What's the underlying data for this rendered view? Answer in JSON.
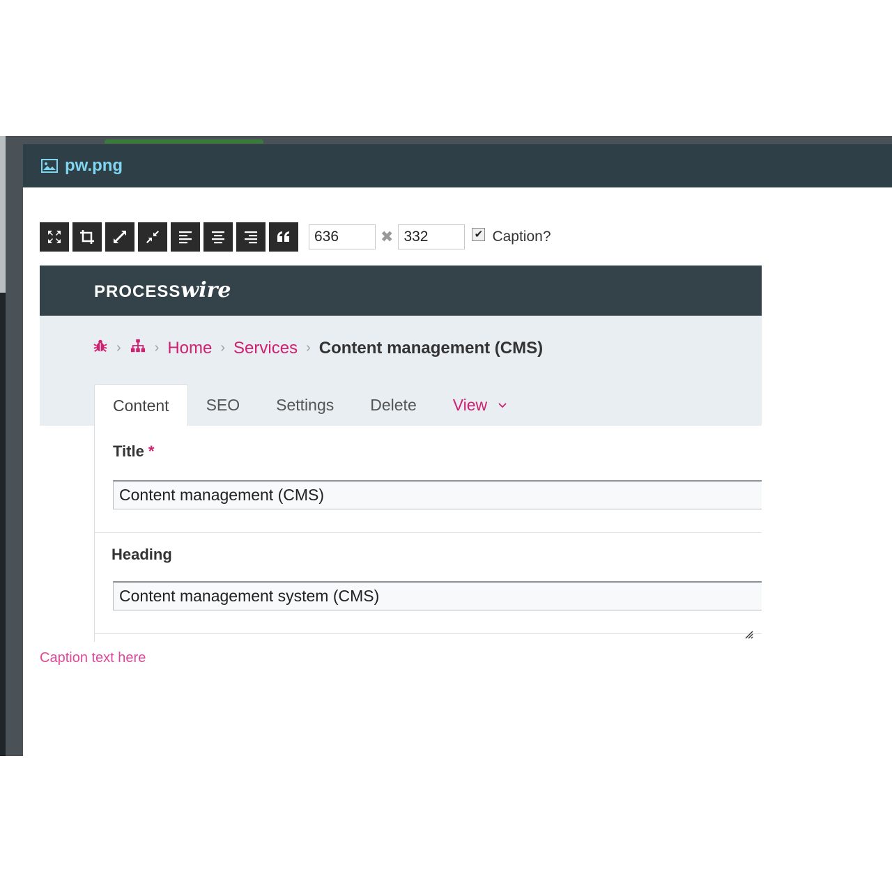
{
  "modal": {
    "title": "pw.png"
  },
  "toolbar": {
    "buttons": [
      {
        "name": "resize-full-button",
        "icon": "expand-arrows-icon"
      },
      {
        "name": "crop-button",
        "icon": "crop-icon"
      },
      {
        "name": "enlarge-button",
        "icon": "arrows-out-icon"
      },
      {
        "name": "shrink-button",
        "icon": "arrows-in-icon"
      },
      {
        "name": "align-left-button",
        "icon": "align-left-icon"
      },
      {
        "name": "align-center-button",
        "icon": "align-center-icon"
      },
      {
        "name": "align-right-button",
        "icon": "align-right-icon"
      },
      {
        "name": "quote-button",
        "icon": "quote-icon"
      }
    ],
    "width_value": "636",
    "height_value": "332",
    "times_symbol": "✖",
    "caption_label": "Caption?",
    "caption_checked": true
  },
  "preview": {
    "logo_text": "PROCESS",
    "logo_script": "wire",
    "breadcrumb": {
      "home": "Home",
      "services": "Services",
      "current": "Content management (CMS)"
    },
    "tabs": [
      "Content",
      "SEO",
      "Settings",
      "Delete",
      "View"
    ],
    "fields": {
      "title_label": "Title",
      "required_mark": "*",
      "title_value": "Content management (CMS)",
      "heading_label": "Heading",
      "heading_value": "Content management system (CMS)"
    }
  },
  "caption_text": "Caption text here",
  "colors": {
    "header_bg": "#2f3f47",
    "title_color": "#7fd6f0",
    "accent_pink": "#cf2071",
    "caption_pink": "#e0479b"
  }
}
